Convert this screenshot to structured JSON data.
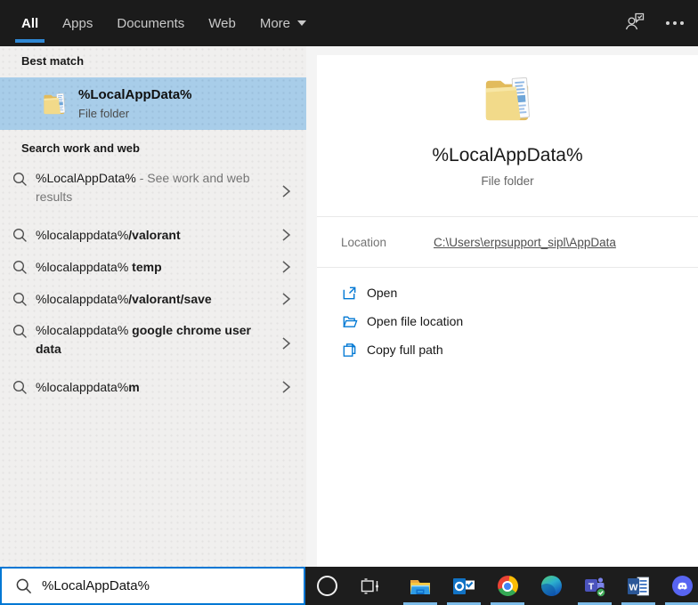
{
  "topbar": {
    "tabs": [
      {
        "label": "All",
        "active": true
      },
      {
        "label": "Apps",
        "active": false
      },
      {
        "label": "Documents",
        "active": false
      },
      {
        "label": "Web",
        "active": false
      }
    ],
    "more_label": "More"
  },
  "left_pane": {
    "best_match_header": "Best match",
    "best_match": {
      "title": "%LocalAppData%",
      "subtitle": "File folder"
    },
    "web_header": "Search work and web",
    "suggestions": [
      {
        "typed": "%LocalAppData%",
        "note": " - See work and web results"
      },
      {
        "typed": "%localappdata%",
        "completion": "/valorant"
      },
      {
        "typed": "%localappdata%",
        "completion": " temp"
      },
      {
        "typed": "%localappdata%",
        "completion": "/valorant/save"
      },
      {
        "typed": "%localappdata%",
        "completion": " google chrome user data"
      },
      {
        "typed": "%localappdata%",
        "completion": "m"
      }
    ]
  },
  "detail_pane": {
    "title": "%LocalAppData%",
    "subtitle": "File folder",
    "location_label": "Location",
    "location_value": "C:\\Users\\erpsupport_sipl\\AppData",
    "actions": [
      {
        "label": "Open"
      },
      {
        "label": "Open file location"
      },
      {
        "label": "Copy full path"
      }
    ]
  },
  "search_box": {
    "value": "%LocalAppData%"
  },
  "taskbar": {
    "buttons": [
      {
        "name": "cortana",
        "open": false
      },
      {
        "name": "task-view",
        "open": false
      },
      {
        "name": "file-explorer",
        "open": true
      },
      {
        "name": "outlook",
        "open": true
      },
      {
        "name": "chrome",
        "open": true
      },
      {
        "name": "edge",
        "open": false
      },
      {
        "name": "teams",
        "open": true
      },
      {
        "name": "word",
        "open": true
      },
      {
        "name": "discord",
        "open": true
      }
    ]
  },
  "colors": {
    "accent_blue": "#0078d4",
    "tab_underline": "#2e87d3",
    "best_match_highlight": "#a8cde9",
    "taskbar_indicator": "#7cbbe8",
    "topbar_bg": "#1b1b1b",
    "taskbar_bg": "#1d1d1d"
  }
}
